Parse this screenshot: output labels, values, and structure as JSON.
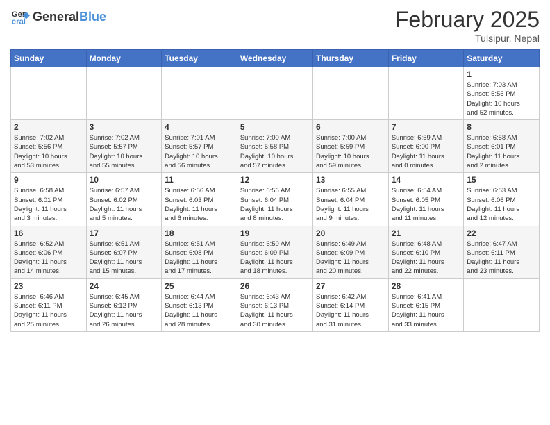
{
  "logo": {
    "general": "General",
    "blue": "Blue"
  },
  "title": {
    "month": "February 2025",
    "location": "Tulsipur, Nepal"
  },
  "weekdays": [
    "Sunday",
    "Monday",
    "Tuesday",
    "Wednesday",
    "Thursday",
    "Friday",
    "Saturday"
  ],
  "weeks": [
    [
      {
        "day": "",
        "info": ""
      },
      {
        "day": "",
        "info": ""
      },
      {
        "day": "",
        "info": ""
      },
      {
        "day": "",
        "info": ""
      },
      {
        "day": "",
        "info": ""
      },
      {
        "day": "",
        "info": ""
      },
      {
        "day": "1",
        "info": "Sunrise: 7:03 AM\nSunset: 5:55 PM\nDaylight: 10 hours\nand 52 minutes."
      }
    ],
    [
      {
        "day": "2",
        "info": "Sunrise: 7:02 AM\nSunset: 5:56 PM\nDaylight: 10 hours\nand 53 minutes."
      },
      {
        "day": "3",
        "info": "Sunrise: 7:02 AM\nSunset: 5:57 PM\nDaylight: 10 hours\nand 55 minutes."
      },
      {
        "day": "4",
        "info": "Sunrise: 7:01 AM\nSunset: 5:57 PM\nDaylight: 10 hours\nand 56 minutes."
      },
      {
        "day": "5",
        "info": "Sunrise: 7:00 AM\nSunset: 5:58 PM\nDaylight: 10 hours\nand 57 minutes."
      },
      {
        "day": "6",
        "info": "Sunrise: 7:00 AM\nSunset: 5:59 PM\nDaylight: 10 hours\nand 59 minutes."
      },
      {
        "day": "7",
        "info": "Sunrise: 6:59 AM\nSunset: 6:00 PM\nDaylight: 11 hours\nand 0 minutes."
      },
      {
        "day": "8",
        "info": "Sunrise: 6:58 AM\nSunset: 6:01 PM\nDaylight: 11 hours\nand 2 minutes."
      }
    ],
    [
      {
        "day": "9",
        "info": "Sunrise: 6:58 AM\nSunset: 6:01 PM\nDaylight: 11 hours\nand 3 minutes."
      },
      {
        "day": "10",
        "info": "Sunrise: 6:57 AM\nSunset: 6:02 PM\nDaylight: 11 hours\nand 5 minutes."
      },
      {
        "day": "11",
        "info": "Sunrise: 6:56 AM\nSunset: 6:03 PM\nDaylight: 11 hours\nand 6 minutes."
      },
      {
        "day": "12",
        "info": "Sunrise: 6:56 AM\nSunset: 6:04 PM\nDaylight: 11 hours\nand 8 minutes."
      },
      {
        "day": "13",
        "info": "Sunrise: 6:55 AM\nSunset: 6:04 PM\nDaylight: 11 hours\nand 9 minutes."
      },
      {
        "day": "14",
        "info": "Sunrise: 6:54 AM\nSunset: 6:05 PM\nDaylight: 11 hours\nand 11 minutes."
      },
      {
        "day": "15",
        "info": "Sunrise: 6:53 AM\nSunset: 6:06 PM\nDaylight: 11 hours\nand 12 minutes."
      }
    ],
    [
      {
        "day": "16",
        "info": "Sunrise: 6:52 AM\nSunset: 6:06 PM\nDaylight: 11 hours\nand 14 minutes."
      },
      {
        "day": "17",
        "info": "Sunrise: 6:51 AM\nSunset: 6:07 PM\nDaylight: 11 hours\nand 15 minutes."
      },
      {
        "day": "18",
        "info": "Sunrise: 6:51 AM\nSunset: 6:08 PM\nDaylight: 11 hours\nand 17 minutes."
      },
      {
        "day": "19",
        "info": "Sunrise: 6:50 AM\nSunset: 6:09 PM\nDaylight: 11 hours\nand 18 minutes."
      },
      {
        "day": "20",
        "info": "Sunrise: 6:49 AM\nSunset: 6:09 PM\nDaylight: 11 hours\nand 20 minutes."
      },
      {
        "day": "21",
        "info": "Sunrise: 6:48 AM\nSunset: 6:10 PM\nDaylight: 11 hours\nand 22 minutes."
      },
      {
        "day": "22",
        "info": "Sunrise: 6:47 AM\nSunset: 6:11 PM\nDaylight: 11 hours\nand 23 minutes."
      }
    ],
    [
      {
        "day": "23",
        "info": "Sunrise: 6:46 AM\nSunset: 6:11 PM\nDaylight: 11 hours\nand 25 minutes."
      },
      {
        "day": "24",
        "info": "Sunrise: 6:45 AM\nSunset: 6:12 PM\nDaylight: 11 hours\nand 26 minutes."
      },
      {
        "day": "25",
        "info": "Sunrise: 6:44 AM\nSunset: 6:13 PM\nDaylight: 11 hours\nand 28 minutes."
      },
      {
        "day": "26",
        "info": "Sunrise: 6:43 AM\nSunset: 6:13 PM\nDaylight: 11 hours\nand 30 minutes."
      },
      {
        "day": "27",
        "info": "Sunrise: 6:42 AM\nSunset: 6:14 PM\nDaylight: 11 hours\nand 31 minutes."
      },
      {
        "day": "28",
        "info": "Sunrise: 6:41 AM\nSunset: 6:15 PM\nDaylight: 11 hours\nand 33 minutes."
      },
      {
        "day": "",
        "info": ""
      }
    ]
  ]
}
